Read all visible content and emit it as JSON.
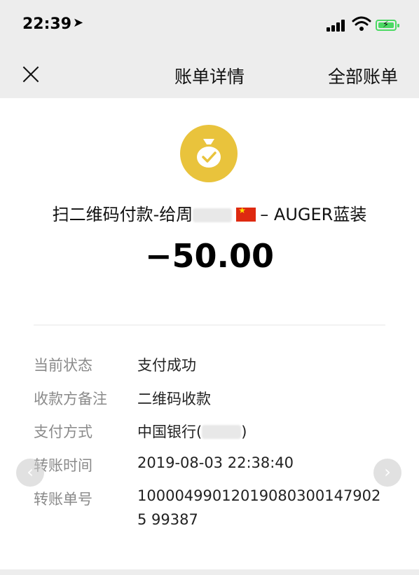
{
  "status_bar": {
    "time": "22:39",
    "location_icon": "location-arrow-icon",
    "signal_icon": "cellular-signal-icon",
    "wifi_icon": "wifi-icon",
    "battery_icon": "battery-charging-icon",
    "battery_color": "#4cd964"
  },
  "nav": {
    "close_icon": "close-icon",
    "title": "账单详情",
    "right_label": "全部账单"
  },
  "header": {
    "coin_icon": "money-bag-check-icon",
    "coin_color": "#e9c33c",
    "merchant_prefix": "扫二维码付款-给周",
    "merchant_suffix": "– AUGER蓝装",
    "flag_icon": "china-flag-icon",
    "amount": "−50.00"
  },
  "details": [
    {
      "label": "当前状态",
      "value": "支付成功"
    },
    {
      "label": "收款方备注",
      "value": "二维码收款"
    },
    {
      "label": "支付方式",
      "value_prefix": "中国银行(",
      "value_suffix": ")"
    },
    {
      "label": "转账时间",
      "value": "2019-08-03 22:38:40"
    },
    {
      "label": "转账单号",
      "value": "100004990120190803001479025 99387"
    }
  ]
}
